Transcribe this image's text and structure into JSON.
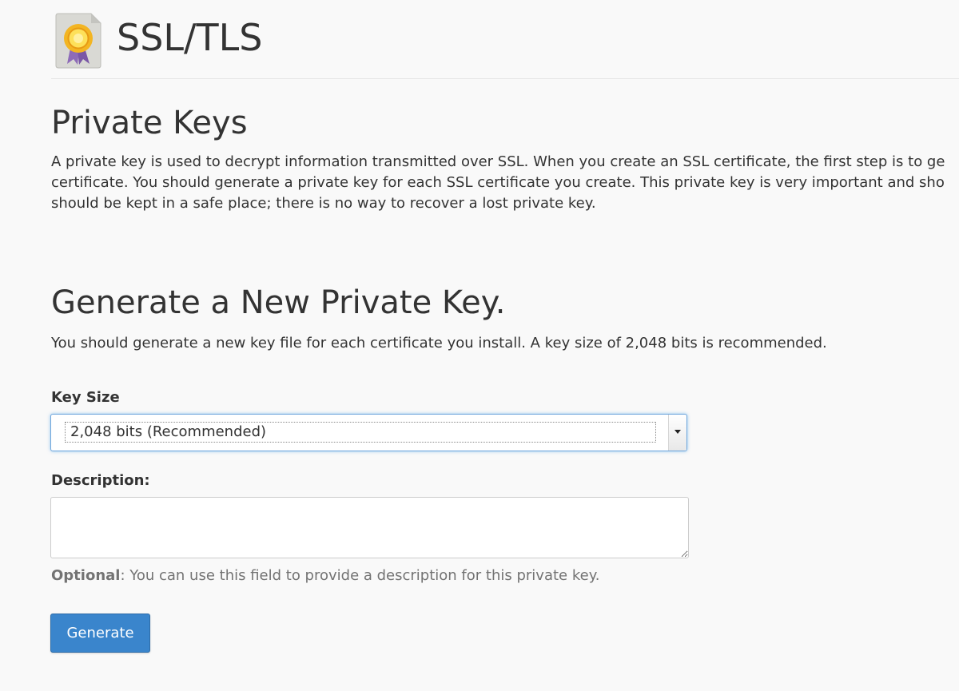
{
  "header": {
    "title": "SSL/TLS",
    "icon": "ssl-certificate-icon"
  },
  "private_keys": {
    "heading": "Private Keys",
    "intro_lines": [
      "A private key is used to decrypt information transmitted over SSL. When you create an SSL certificate, the first step is to ge",
      "certificate. You should generate a private key for each SSL certificate you create. This private key is very important and sho",
      "should be kept in a safe place; there is no way to recover a lost private key."
    ]
  },
  "generate": {
    "heading": "Generate a New Private Key.",
    "text": "You should generate a new key file for each certificate you install. A key size of 2,048 bits is recommended."
  },
  "key_size": {
    "label": "Key Size",
    "selected": "2,048 bits (Recommended)"
  },
  "description": {
    "label": "Description:",
    "value": "",
    "help_strong": "Optional",
    "help_rest": ": You can use this field to provide a description for this private key."
  },
  "actions": {
    "generate_label": "Generate"
  },
  "colors": {
    "primary_button": "#3a85cc",
    "focus_border": "#6fa6dc",
    "background": "#f9f9f9"
  }
}
